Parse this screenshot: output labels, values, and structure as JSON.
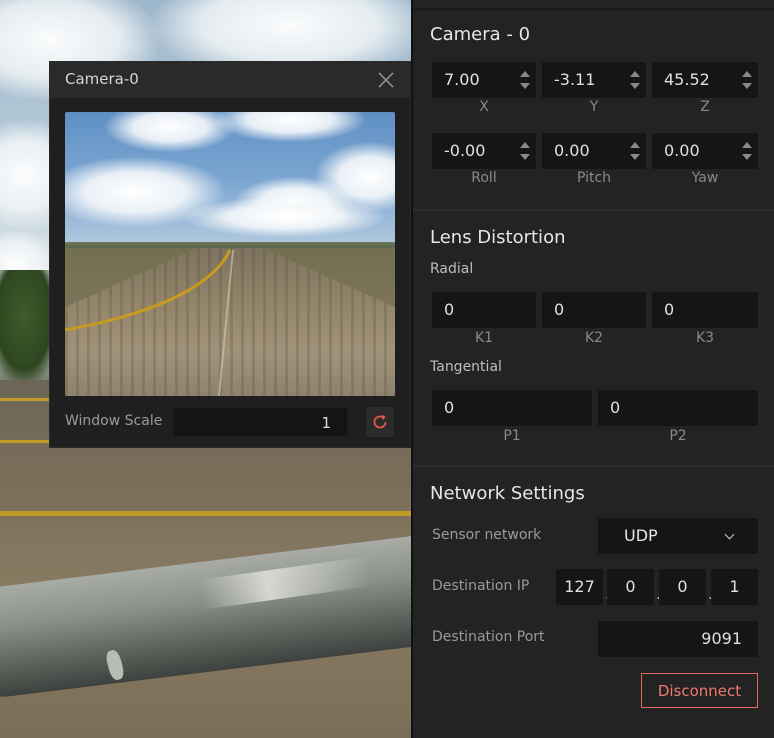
{
  "camera_window": {
    "title": "Camera-0",
    "window_scale_label": "Window Scale",
    "window_scale_value": "1"
  },
  "panel": {
    "camera": {
      "title": "Camera - 0",
      "position": [
        {
          "label": "X",
          "value": "7.00"
        },
        {
          "label": "Y",
          "value": "-3.11"
        },
        {
          "label": "Z",
          "value": "45.52"
        }
      ],
      "rotation": [
        {
          "label": "Roll",
          "value": "-0.00"
        },
        {
          "label": "Pitch",
          "value": "0.00"
        },
        {
          "label": "Yaw",
          "value": "0.00"
        }
      ]
    },
    "lens": {
      "title": "Lens Distortion",
      "radial_label": "Radial",
      "radial": [
        {
          "label": "K1",
          "value": "0"
        },
        {
          "label": "K2",
          "value": "0"
        },
        {
          "label": "K3",
          "value": "0"
        }
      ],
      "tangential_label": "Tangential",
      "tangential": [
        {
          "label": "P1",
          "value": "0"
        },
        {
          "label": "P2",
          "value": "0"
        }
      ]
    },
    "network": {
      "title": "Network Settings",
      "sensor_network_label": "Sensor network",
      "sensor_network_value": "UDP",
      "destination_ip_label": "Destination IP",
      "ip": [
        "127",
        "0",
        "0",
        "1"
      ],
      "destination_port_label": "Destination Port",
      "port": "9091",
      "disconnect_label": "Disconnect"
    }
  },
  "colors": {
    "panel_bg": "#232323",
    "field_bg": "#151515",
    "accent": "#ef7a6c",
    "runway_line": "#c39a28"
  },
  "icons": {
    "close": "close-icon",
    "reset": "refresh-icon",
    "spinner": "spinner-arrows-icon",
    "dropdown": "chevron-down-icon"
  }
}
